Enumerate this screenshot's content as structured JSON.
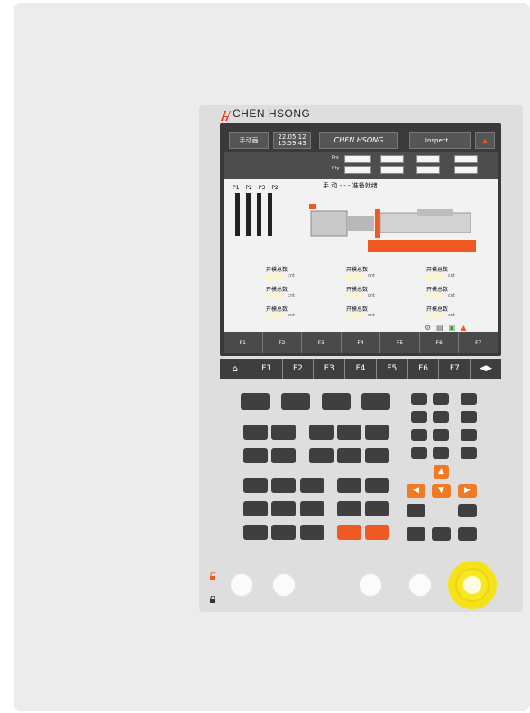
{
  "brand": {
    "logo_text": "CHEN HSONG",
    "screen_logo_text": "CHEN HSONG"
  },
  "topbar": {
    "page": "手动画",
    "date": "22.05.12",
    "time": "15:59:43",
    "user": "Inspect..."
  },
  "status": {
    "labels": [
      "Prs",
      "Cty"
    ]
  },
  "main": {
    "mode_title": "手 动 - - - 准备就绪",
    "gauges": [
      "P1",
      "P2",
      "P3",
      "P2"
    ],
    "counters": [
      {
        "label": "开模总数",
        "unit": "cnt"
      },
      {
        "label": "开模总数",
        "unit": "cnt"
      },
      {
        "label": "开模总数",
        "unit": "cnt"
      },
      {
        "label": "开模总数",
        "unit": "cnt"
      },
      {
        "label": "开模总数",
        "unit": "cnt"
      },
      {
        "label": "开模总数",
        "unit": "cnt"
      },
      {
        "label": "开模总数",
        "unit": "cnt"
      },
      {
        "label": "开模总数",
        "unit": "cnt"
      },
      {
        "label": "开模总数",
        "unit": "cnt"
      }
    ]
  },
  "fnbar": [
    "F1",
    "F2",
    "F3",
    "F4",
    "F5",
    "F6",
    "F7"
  ],
  "fkeys": [
    "F1",
    "F2",
    "F3",
    "F4",
    "F5",
    "F6",
    "F7"
  ],
  "colors": {
    "accent": "#ee5a22",
    "yellow": "#f5e21a",
    "screen_bg": "#5b5b5b",
    "key_bg": "#3f3f3f"
  }
}
